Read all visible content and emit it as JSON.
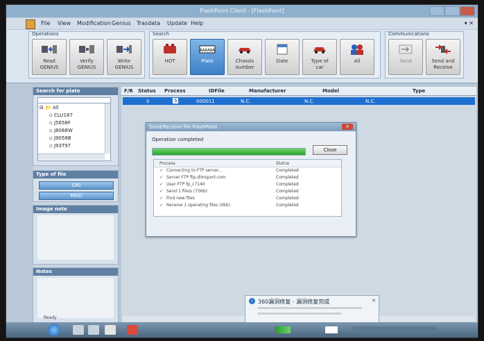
{
  "window": {
    "title": "FlashPoint Client - [FlashPoint]"
  },
  "menu": [
    "File",
    "View",
    "Modification",
    "Genius",
    "Trasdata",
    "Update",
    "Help"
  ],
  "ribbon": {
    "operations": {
      "title": "Operations",
      "buttons": [
        {
          "line1": "Read",
          "line2": "GENIUS"
        },
        {
          "line1": "Verify",
          "line2": "GENIUS"
        },
        {
          "line1": "Write",
          "line2": "GENIUS"
        }
      ]
    },
    "search": {
      "title": "Search",
      "buttons": [
        {
          "line1": "HOT",
          "line2": ""
        },
        {
          "line1": "Plate",
          "line2": ""
        },
        {
          "line1": "Chassis",
          "line2": "number"
        },
        {
          "line1": "Date",
          "line2": ""
        },
        {
          "line1": "Type of",
          "line2": "car"
        },
        {
          "line1": "All",
          "line2": ""
        }
      ]
    },
    "communications": {
      "title": "Communications",
      "buttons": [
        {
          "line1": "Send",
          "line2": ""
        },
        {
          "line1": "Send and",
          "line2": "Receive"
        }
      ]
    }
  },
  "left_panel": {
    "search_for_plate": "Search for plate",
    "tree": [
      "All",
      "CLU187",
      "J5658F",
      "J8068W",
      "J9058B",
      "J93T97"
    ],
    "type_of_file": "Type of file",
    "file_buttons": [
      "ORI",
      "MOD"
    ],
    "image_note": "Image note",
    "notes": "Notes"
  },
  "table": {
    "columns": [
      "F/R",
      "Status",
      "Process",
      "IDFile",
      "Manufacturer",
      "Model",
      "Type"
    ],
    "rows": [
      {
        "status": "0",
        "process": "S",
        "idfile": "000011",
        "manufacturer": "N.C.",
        "model": "N.C.",
        "type": "N.C."
      }
    ]
  },
  "dialog": {
    "title": "Send/Receive file FlashPoint",
    "message": "Operation completed",
    "progress": 1.0,
    "close_button": "Close",
    "col_process": "Process",
    "col_status": "Status",
    "rows": [
      {
        "process": "Connecting to FTP server...",
        "status": "Completed"
      },
      {
        "process": "Server FTP ftp.dimsport.com",
        "status": "Completed"
      },
      {
        "process": "User FTP fp_c7140",
        "status": "Completed"
      },
      {
        "process": "Send 1 file/s (75Kb)",
        "status": "Completed"
      },
      {
        "process": "Find new files",
        "status": "Completed"
      },
      {
        "process": "Receive 1 operating files (0kb)",
        "status": "Completed"
      }
    ]
  },
  "notification": {
    "title": "360漏洞修复 - 漏洞修复完成"
  },
  "statusbar": {
    "text": "Ready"
  },
  "colors": {
    "selected_row": "#1e6fd0",
    "progress": "#2da42d",
    "title": "#8fb0cd"
  }
}
